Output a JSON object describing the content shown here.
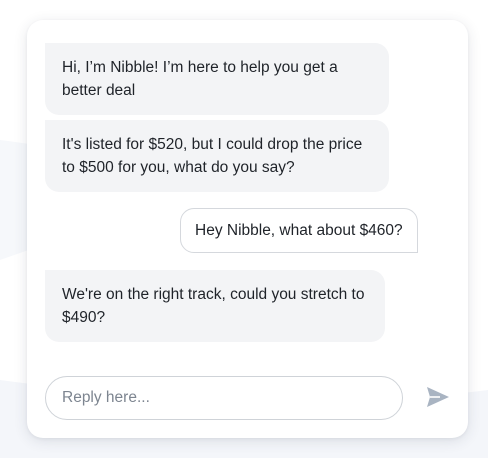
{
  "chat": {
    "messages": [
      {
        "role": "bot",
        "text": "Hi, I’m Nibble! I’m here to help you get a better deal"
      },
      {
        "role": "bot",
        "text": "It's listed for $520, but I could drop the price to $500 for you, what do you say?"
      },
      {
        "role": "user",
        "text": "Hey Nibble, what about $460?"
      },
      {
        "role": "bot",
        "text": "We're on the right track, could you stretch to $490?"
      }
    ]
  },
  "composer": {
    "placeholder": "Reply here...",
    "value": "",
    "send_icon": "send-icon"
  },
  "colors": {
    "bot_bubble": "#f3f4f6",
    "user_bubble_border": "#d5d8dd",
    "text": "#1f2329",
    "send_icon": "#a9b4c2"
  }
}
